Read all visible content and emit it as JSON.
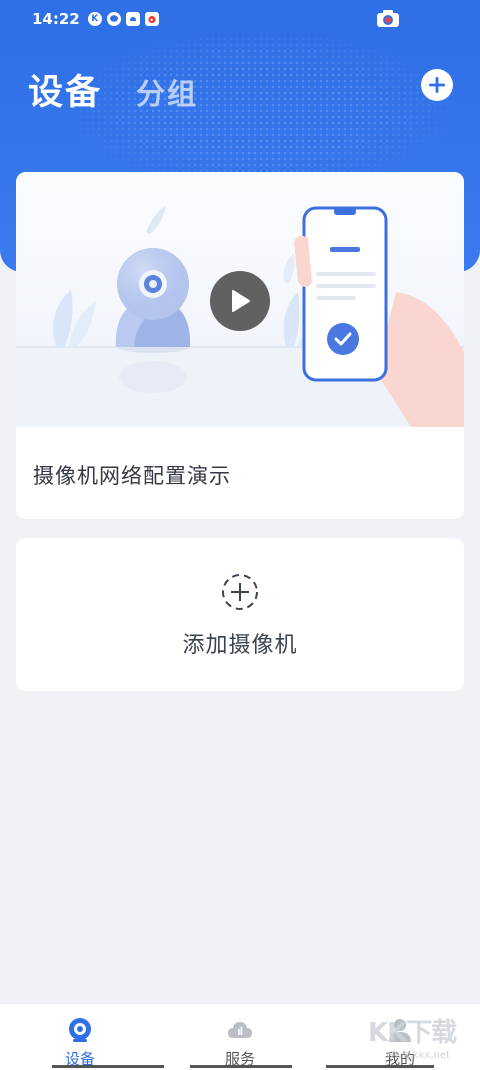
{
  "status_bar": {
    "time": "14:22",
    "icons": [
      "k-icon",
      "chat-icon",
      "cloud-app-icon",
      "weibo-icon"
    ],
    "right_icon": "camera-icon"
  },
  "header": {
    "tab_devices": "设备",
    "tab_groups": "分组",
    "add_icon": "plus-circle-icon",
    "accent_color": "#2f6fe6"
  },
  "demo_card": {
    "title": "摄像机网络配置演示",
    "play_icon": "play-icon"
  },
  "add_card": {
    "label": "添加摄像机",
    "icon": "dashed-plus-icon"
  },
  "bottom_nav": {
    "items": [
      {
        "label": "设备",
        "icon": "camera-icon",
        "active": true
      },
      {
        "label": "服务",
        "icon": "cloud-icon",
        "active": false
      },
      {
        "label": "我的",
        "icon": "user-icon",
        "active": false
      }
    ]
  },
  "watermark": {
    "text": "KK下载",
    "sub": "www.kkx.net"
  }
}
